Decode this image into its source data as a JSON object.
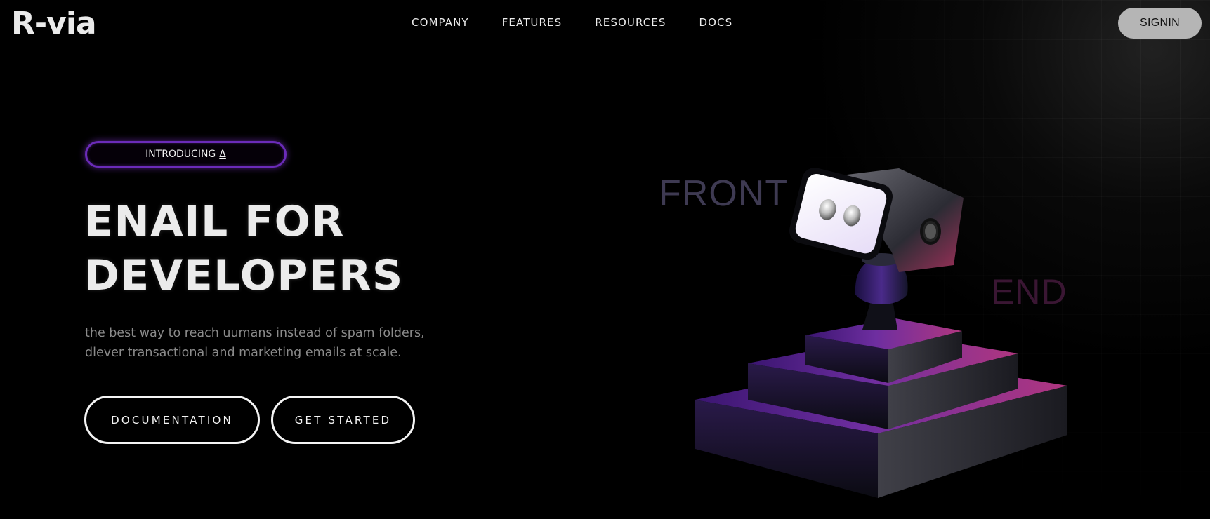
{
  "header": {
    "logo": "R-via",
    "nav": [
      "COMPANY",
      "FEATURES",
      "RESOURCES",
      "DOCS"
    ],
    "signin_label": "SIGNIN"
  },
  "hero": {
    "badge_label": "INTRODUCING",
    "badge_glyph": "Δ",
    "headline_line1": "ENAIL FOR",
    "headline_line2": "DEVELOPERS",
    "subtitle_line1": "the best way to reach uumans instead of spam folders,",
    "subtitle_line2": "dlever transactional and marketing emails at scale.",
    "docs_button": "DOCUMENTATION",
    "start_button": "GET STARTED"
  },
  "visual": {
    "word_front": "FRONT",
    "word_end": "END"
  },
  "colors": {
    "background": "#000000",
    "accent_purple": "#6a2bb8",
    "signin_bg": "#b5b5b5"
  }
}
